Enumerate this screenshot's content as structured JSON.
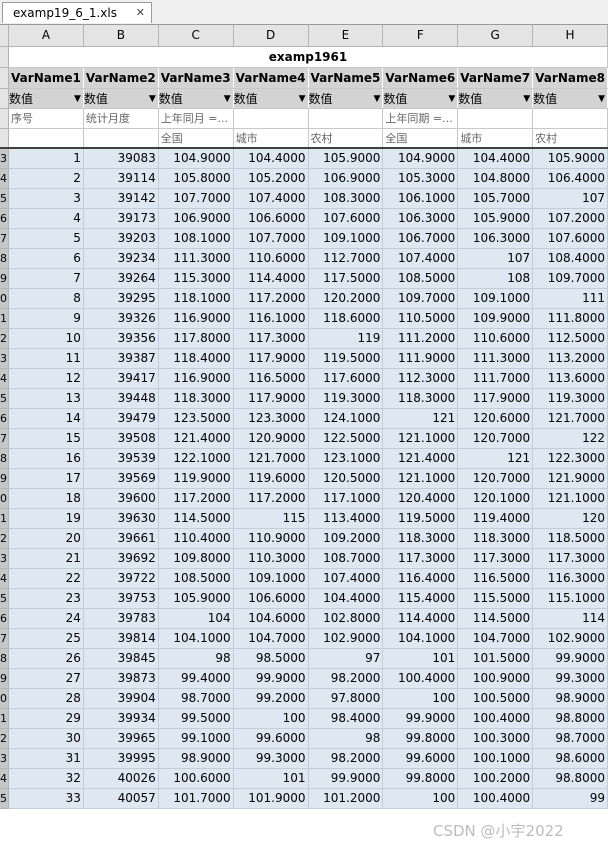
{
  "tab": {
    "title": "examp19_6_1.xls",
    "close": "✕"
  },
  "columns": [
    "A",
    "B",
    "C",
    "D",
    "E",
    "F",
    "G",
    "H"
  ],
  "sheet_title": "examp1961",
  "var_names": [
    "VarName1",
    "VarName2",
    "VarName3",
    "VarName4",
    "VarName5",
    "VarName6",
    "VarName7",
    "VarName8"
  ],
  "var_types": [
    "数值",
    "数值",
    "数值",
    "数值",
    "数值",
    "数值",
    "数值",
    "数值"
  ],
  "labels1": [
    "序号",
    "统计月度",
    "上年同月 =...",
    "",
    "",
    "上年同期 =...",
    "",
    ""
  ],
  "labels2": [
    "",
    "",
    "全国",
    "城市",
    "农村",
    "全国",
    "城市",
    "农村"
  ],
  "header_row_numbers": [
    "",
    "",
    "",
    "",
    ""
  ],
  "row_numbers": [
    "3",
    "4",
    "5",
    "6",
    "7",
    "8",
    "9",
    "0",
    "1",
    "2",
    "3",
    "4",
    "5",
    "6",
    "7",
    "8",
    "9",
    "0",
    "1",
    "2",
    "3",
    "4",
    "5",
    "6",
    "7",
    "8",
    "9",
    "0",
    "1",
    "2",
    "3",
    "4",
    "5"
  ],
  "rows": [
    [
      "1",
      "39083",
      "104.9000",
      "104.4000",
      "105.9000",
      "104.9000",
      "104.4000",
      "105.9000"
    ],
    [
      "2",
      "39114",
      "105.8000",
      "105.2000",
      "106.9000",
      "105.3000",
      "104.8000",
      "106.4000"
    ],
    [
      "3",
      "39142",
      "107.7000",
      "107.4000",
      "108.3000",
      "106.1000",
      "105.7000",
      "107"
    ],
    [
      "4",
      "39173",
      "106.9000",
      "106.6000",
      "107.6000",
      "106.3000",
      "105.9000",
      "107.2000"
    ],
    [
      "5",
      "39203",
      "108.1000",
      "107.7000",
      "109.1000",
      "106.7000",
      "106.3000",
      "107.6000"
    ],
    [
      "6",
      "39234",
      "111.3000",
      "110.6000",
      "112.7000",
      "107.4000",
      "107",
      "108.4000"
    ],
    [
      "7",
      "39264",
      "115.3000",
      "114.4000",
      "117.5000",
      "108.5000",
      "108",
      "109.7000"
    ],
    [
      "8",
      "39295",
      "118.1000",
      "117.2000",
      "120.2000",
      "109.7000",
      "109.1000",
      "111"
    ],
    [
      "9",
      "39326",
      "116.9000",
      "116.1000",
      "118.6000",
      "110.5000",
      "109.9000",
      "111.8000"
    ],
    [
      "10",
      "39356",
      "117.8000",
      "117.3000",
      "119",
      "111.2000",
      "110.6000",
      "112.5000"
    ],
    [
      "11",
      "39387",
      "118.4000",
      "117.9000",
      "119.5000",
      "111.9000",
      "111.3000",
      "113.2000"
    ],
    [
      "12",
      "39417",
      "116.9000",
      "116.5000",
      "117.6000",
      "112.3000",
      "111.7000",
      "113.6000"
    ],
    [
      "13",
      "39448",
      "118.3000",
      "117.9000",
      "119.3000",
      "118.3000",
      "117.9000",
      "119.3000"
    ],
    [
      "14",
      "39479",
      "123.5000",
      "123.3000",
      "124.1000",
      "121",
      "120.6000",
      "121.7000"
    ],
    [
      "15",
      "39508",
      "121.4000",
      "120.9000",
      "122.5000",
      "121.1000",
      "120.7000",
      "122"
    ],
    [
      "16",
      "39539",
      "122.1000",
      "121.7000",
      "123.1000",
      "121.4000",
      "121",
      "122.3000"
    ],
    [
      "17",
      "39569",
      "119.9000",
      "119.6000",
      "120.5000",
      "121.1000",
      "120.7000",
      "121.9000"
    ],
    [
      "18",
      "39600",
      "117.2000",
      "117.2000",
      "117.1000",
      "120.4000",
      "120.1000",
      "121.1000"
    ],
    [
      "19",
      "39630",
      "114.5000",
      "115",
      "113.4000",
      "119.5000",
      "119.4000",
      "120"
    ],
    [
      "20",
      "39661",
      "110.4000",
      "110.9000",
      "109.2000",
      "118.3000",
      "118.3000",
      "118.5000"
    ],
    [
      "21",
      "39692",
      "109.8000",
      "110.3000",
      "108.7000",
      "117.3000",
      "117.3000",
      "117.3000"
    ],
    [
      "22",
      "39722",
      "108.5000",
      "109.1000",
      "107.4000",
      "116.4000",
      "116.5000",
      "116.3000"
    ],
    [
      "23",
      "39753",
      "105.9000",
      "106.6000",
      "104.4000",
      "115.4000",
      "115.5000",
      "115.1000"
    ],
    [
      "24",
      "39783",
      "104",
      "104.6000",
      "102.8000",
      "114.4000",
      "114.5000",
      "114"
    ],
    [
      "25",
      "39814",
      "104.1000",
      "104.7000",
      "102.9000",
      "104.1000",
      "104.7000",
      "102.9000"
    ],
    [
      "26",
      "39845",
      "98",
      "98.5000",
      "97",
      "101",
      "101.5000",
      "99.9000"
    ],
    [
      "27",
      "39873",
      "99.4000",
      "99.9000",
      "98.2000",
      "100.4000",
      "100.9000",
      "99.3000"
    ],
    [
      "28",
      "39904",
      "98.7000",
      "99.2000",
      "97.8000",
      "100",
      "100.5000",
      "98.9000"
    ],
    [
      "29",
      "39934",
      "99.5000",
      "100",
      "98.4000",
      "99.9000",
      "100.4000",
      "98.8000"
    ],
    [
      "30",
      "39965",
      "99.1000",
      "99.6000",
      "98",
      "99.8000",
      "100.3000",
      "98.7000"
    ],
    [
      "31",
      "39995",
      "98.9000",
      "99.3000",
      "98.2000",
      "99.6000",
      "100.1000",
      "98.6000"
    ],
    [
      "32",
      "40026",
      "100.6000",
      "101",
      "99.9000",
      "99.8000",
      "100.2000",
      "98.8000"
    ],
    [
      "33",
      "40057",
      "101.7000",
      "101.9000",
      "101.2000",
      "100",
      "100.4000",
      "99"
    ]
  ],
  "watermark": "CSDN @小宇2022"
}
